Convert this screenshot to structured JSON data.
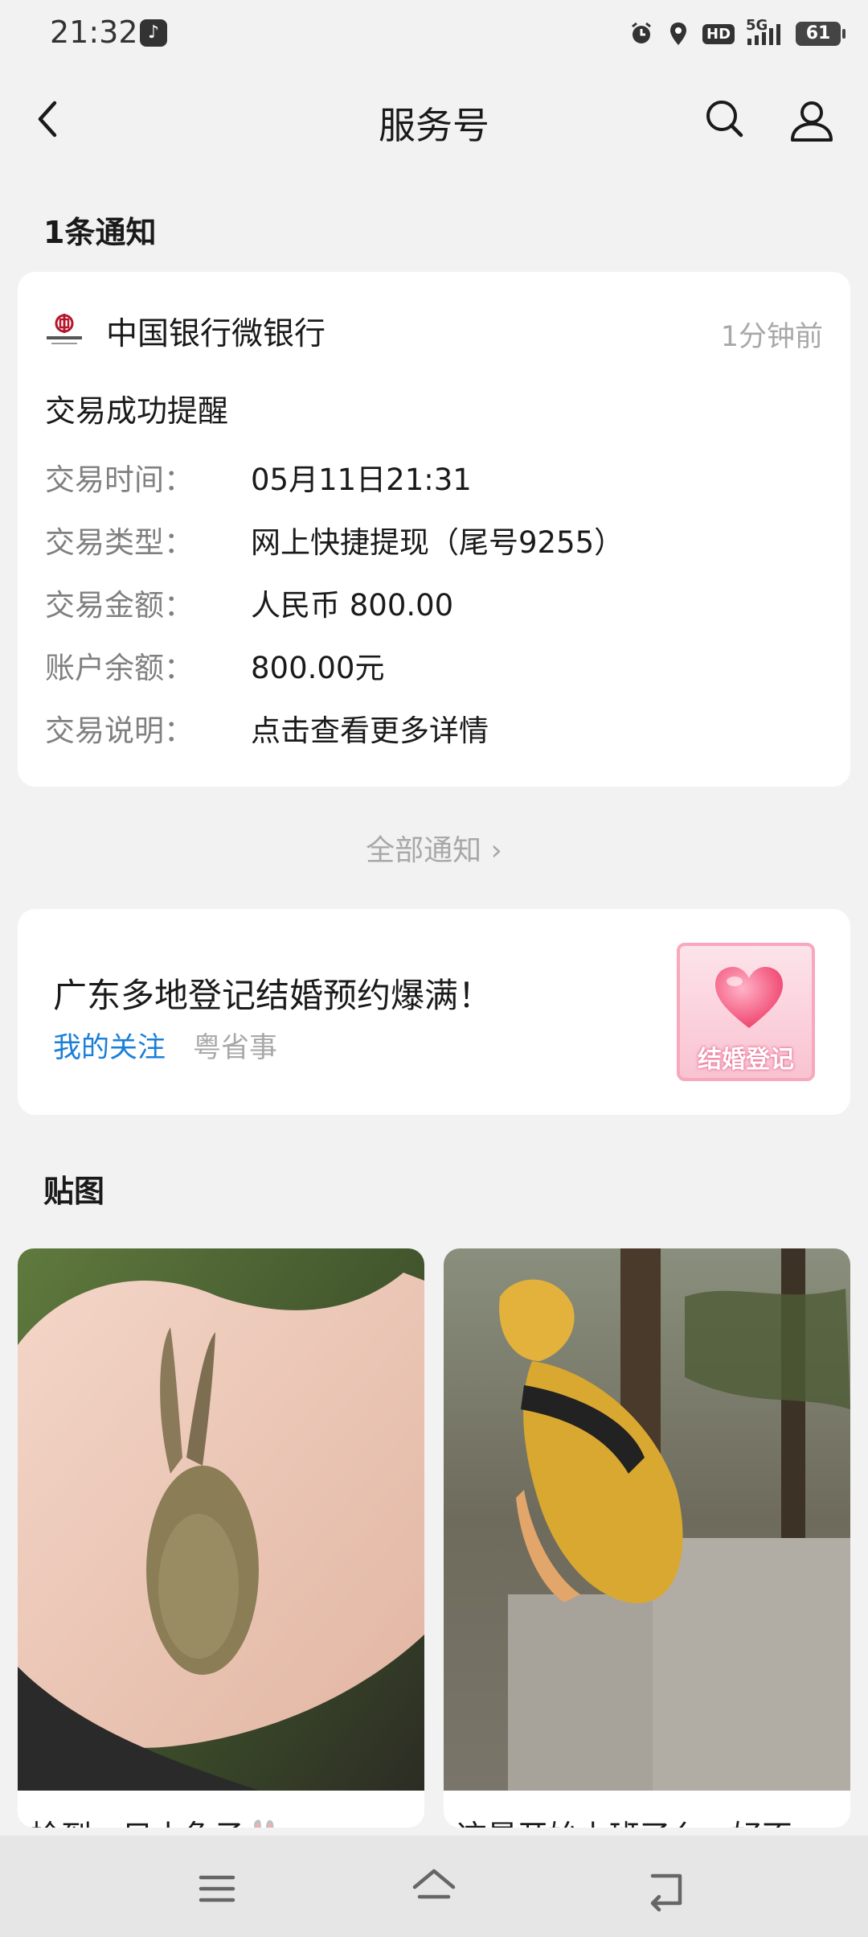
{
  "status_bar": {
    "time": "21:32",
    "network": "5G",
    "hd": "HD",
    "battery": "61",
    "icons": [
      "tiktok-icon",
      "alarm-icon",
      "location-icon",
      "hd-icon",
      "signal-icon",
      "battery-icon"
    ]
  },
  "header": {
    "title": "服务号",
    "icons": [
      "back-icon",
      "search-icon",
      "profile-icon"
    ]
  },
  "notifications": {
    "section_title": "1条通知",
    "card": {
      "sender": "中国银行微银行",
      "time": "1分钟前",
      "title": "交易成功提醒",
      "rows": [
        {
          "label": "交易时间：",
          "value": "05月11日21:31"
        },
        {
          "label": "交易类型：",
          "value": "网上快捷提现（尾号9255）"
        },
        {
          "label": "交易金额：",
          "value": "人民币 800.00"
        },
        {
          "label": "账户余额：",
          "value": "800.00元"
        },
        {
          "label": "交易说明：",
          "value": "点击查看更多详情"
        }
      ]
    },
    "all_link": "全部通知 ›"
  },
  "article": {
    "title": "广东多地登记结婚预约爆满！",
    "tag": "我的关注",
    "source": "粤省事",
    "thumb_text": "结婚登记"
  },
  "stickers": {
    "section_title": "贴图",
    "items": [
      {
        "caption": "捡到一只小兔子🐰"
      },
      {
        "caption": "这是开始上班了么，好不"
      }
    ]
  },
  "nav": {
    "icons": [
      "menu-icon",
      "home-icon",
      "return-icon"
    ]
  },
  "colors": {
    "background": "#f2f2f2",
    "card": "#ffffff",
    "link_blue": "#1a7fd9",
    "muted": "#a8a8a8"
  }
}
